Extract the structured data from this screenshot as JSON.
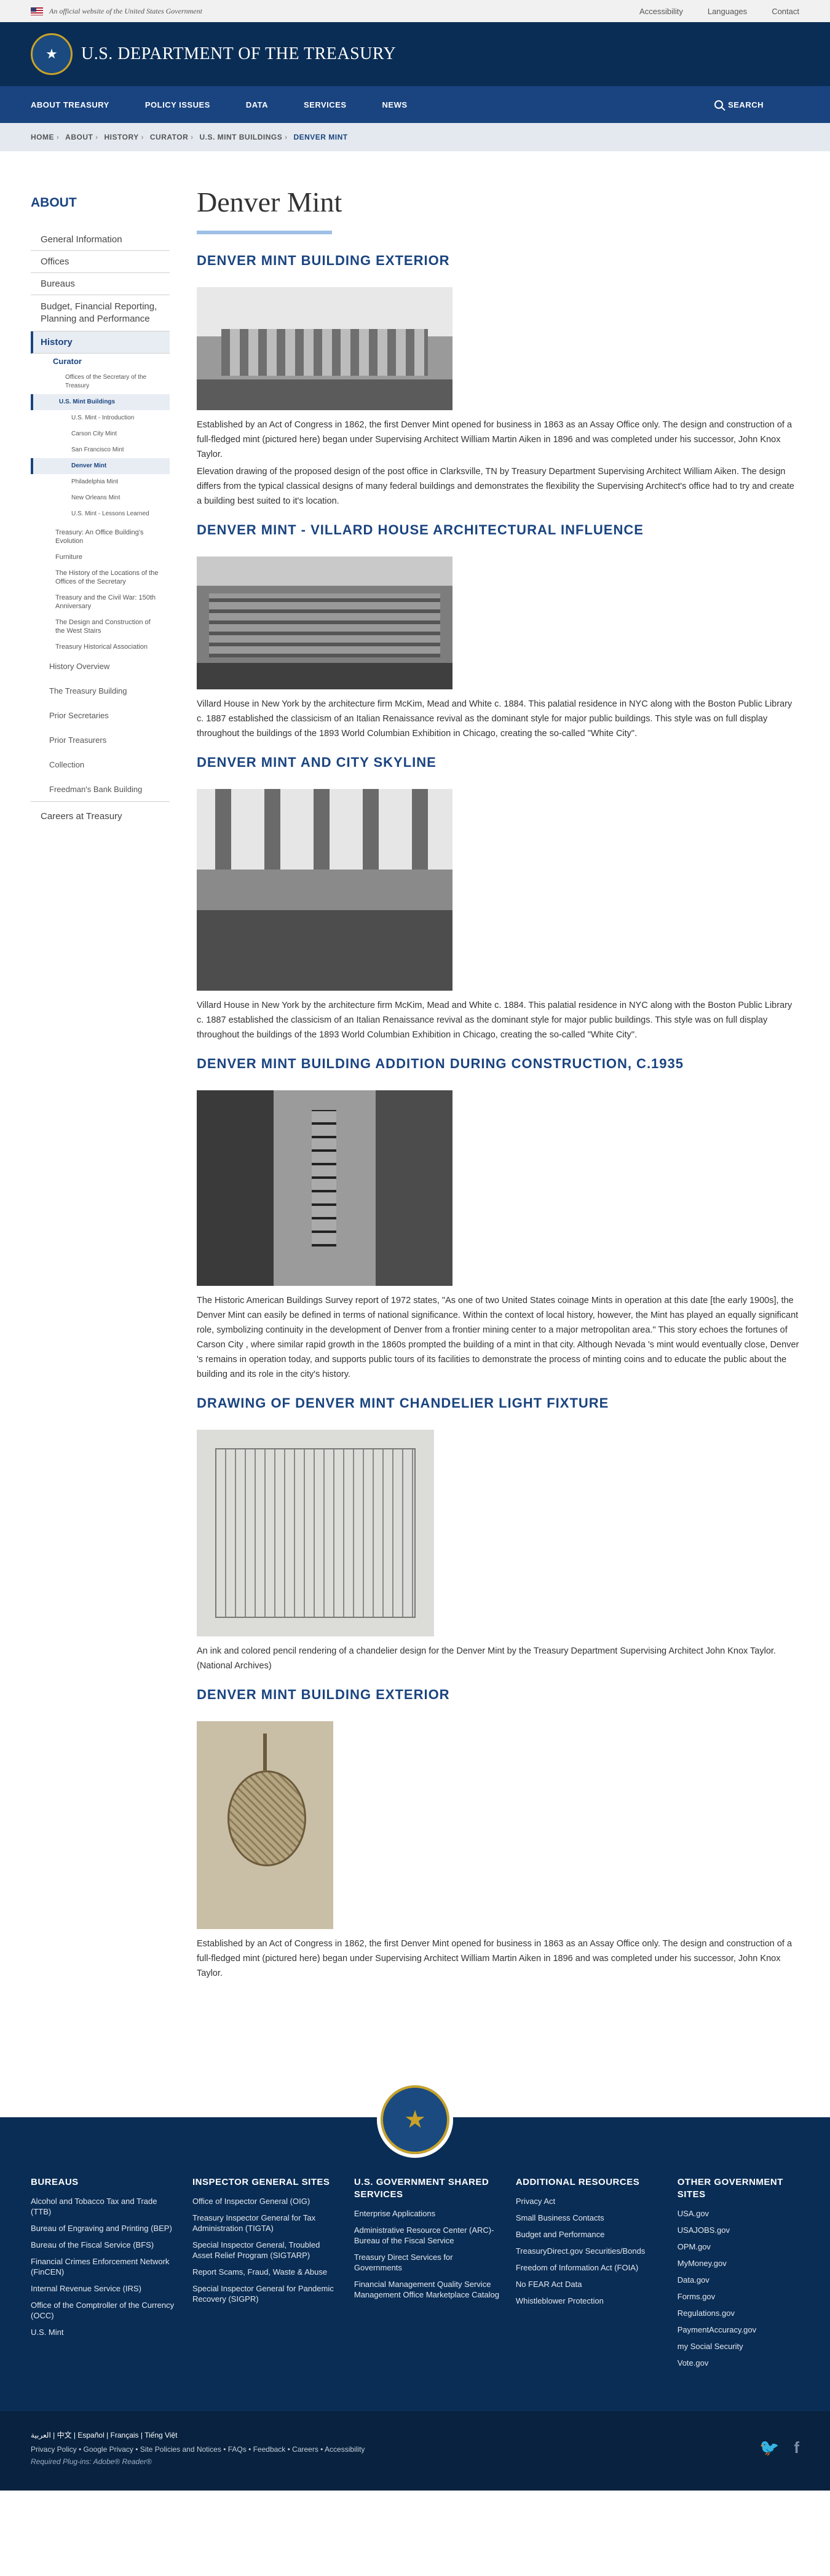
{
  "banner": {
    "official": "An official website of the United States Government",
    "links": [
      "Accessibility",
      "Languages",
      "Contact"
    ]
  },
  "header": {
    "site_title": "U.S. DEPARTMENT OF THE TREASURY"
  },
  "nav": {
    "items": [
      "ABOUT TREASURY",
      "POLICY ISSUES",
      "DATA",
      "SERVICES",
      "NEWS"
    ],
    "search": "SEARCH"
  },
  "breadcrumb": [
    "HOME",
    "ABOUT",
    "HISTORY",
    "CURATOR",
    "U.S. MINT BUILDINGS",
    "DENVER MINT"
  ],
  "sidebar": {
    "heading": "ABOUT",
    "top_items": [
      "General Information",
      "Offices",
      "Bureaus",
      "Budget, Financial Reporting, Planning and Performance"
    ],
    "history": "History",
    "curator": "Curator",
    "curator_items": [
      "Offices of the Secretary of the Treasury"
    ],
    "mint_buildings": "U.S. Mint Buildings",
    "mint_items": [
      "U.S. Mint - Introduction",
      "Carson City Mint",
      "San Francisco Mint",
      "Denver Mint",
      "Philadelphia Mint",
      "New Orleans Mint",
      "U.S. Mint - Lessons Learned"
    ],
    "curator_after": [
      "Treasury: An Office Building's Evolution",
      "Furniture",
      "The History of the Locations of the Offices of the Secretary",
      "Treasury and the Civil War: 150th Anniversary",
      "The Design and Construction of the West Stairs",
      "Treasury Historical Association"
    ],
    "history_after": [
      "History Overview",
      "The Treasury Building",
      "Prior Secretaries",
      "Prior Treasurers",
      "Collection",
      "Freedman's Bank Building"
    ],
    "bottom": "Careers at Treasury"
  },
  "page": {
    "title": "Denver Mint",
    "sections": [
      {
        "heading": "DENVER MINT BUILDING EXTERIOR",
        "paragraphs": [
          "Established by an Act of Congress in 1862, the first Denver Mint opened for business in 1863 as an Assay Office only. The design and construction of a full-fledged mint (pictured here) began under Supervising Architect William Martin Aiken in 1896 and was completed under his successor, John Knox Taylor.",
          "Elevation drawing of the proposed design of the post office in Clarksville, TN by Treasury Department Supervising Architect William Aiken. The design differs from the typical classical designs of many federal buildings and demonstrates the flexibility the Supervising Architect's office had to try and create a building best suited to it's location."
        ]
      },
      {
        "heading": "DENVER MINT - VILLARD HOUSE ARCHITECTURAL INFLUENCE",
        "paragraphs": [
          "Villard House in New York by the architecture firm McKim, Mead and White c. 1884. This palatial residence in NYC along with the Boston Public Library c. 1887 established the classicism of an Italian Renaissance revival as the dominant style for major public buildings. This style was on full display throughout the buildings of the 1893 World Columbian Exhibition in Chicago, creating the so-called \"White City\"."
        ]
      },
      {
        "heading": "DENVER MINT AND CITY SKYLINE",
        "paragraphs": [
          "Villard House in New York by the architecture firm McKim, Mead and White c. 1884. This palatial residence in NYC along with the Boston Public Library c. 1887 established the classicism of an Italian Renaissance revival as the dominant style for major public buildings. This style was on full display throughout the buildings of the 1893 World Columbian Exhibition in Chicago, creating the so-called \"White City\"."
        ]
      },
      {
        "heading": "DENVER MINT BUILDING ADDITION DURING CONSTRUCTION, C.1935",
        "paragraphs": [
          "The Historic American Buildings Survey report of 1972 states, \"As one of two United States coinage Mints in operation at this date [the early 1900s], the Denver Mint can easily be defined in terms of national significance. Within the context of local history, however, the Mint has played an equally significant role, symbolizing continuity in the development of Denver from a frontier mining center to a major metropolitan area.\" This story echoes the fortunes of Carson City , where similar rapid growth in the 1860s prompted the building of a mint in that city. Although Nevada 's mint would eventually close, Denver 's remains in operation today, and supports public tours of its facilities to demonstrate the process of minting coins and to educate the public about the building and its role in the city's history."
        ]
      },
      {
        "heading": "DRAWING OF DENVER MINT CHANDELIER LIGHT FIXTURE",
        "paragraphs": [
          "An ink and colored pencil rendering of a chandelier design for the Denver Mint by the Treasury Department Supervising Architect John Knox Taylor. (National Archives)"
        ]
      },
      {
        "heading": "DENVER MINT BUILDING EXTERIOR",
        "paragraphs": [
          "Established by an Act of Congress in 1862, the first Denver Mint opened for business in 1863 as an Assay Office only. The design and construction of a full-fledged mint (pictured here) began under Supervising Architect William Martin Aiken in 1896 and was completed under his successor, John Knox Taylor."
        ]
      }
    ]
  },
  "footer": {
    "columns": [
      {
        "heading": "BUREAUS",
        "links": [
          "Alcohol and Tobacco Tax and Trade (TTB)",
          "Bureau of Engraving and Printing (BEP)",
          "Bureau of the Fiscal Service (BFS)",
          "Financial Crimes Enforcement Network (FinCEN)",
          "Internal Revenue Service (IRS)",
          "Office of the Comptroller of the Currency (OCC)",
          "U.S. Mint"
        ]
      },
      {
        "heading": "INSPECTOR GENERAL SITES",
        "links": [
          "Office of Inspector General (OIG)",
          "Treasury Inspector General for Tax Administration (TIGTA)",
          "Special Inspector General, Troubled Asset Relief Program (SIGTARP)",
          "Report Scams, Fraud, Waste & Abuse",
          "Special Inspector General for Pandemic Recovery (SIGPR)"
        ]
      },
      {
        "heading": "U.S. GOVERNMENT SHARED SERVICES",
        "links": [
          "Enterprise Applications",
          "Administrative Resource Center (ARC)- Bureau of the Fiscal Service",
          "Treasury Direct Services for Governments",
          "Financial Management Quality Service Management Office Marketplace Catalog"
        ]
      },
      {
        "heading": "ADDITIONAL RESOURCES",
        "links": [
          "Privacy Act",
          "Small Business Contacts",
          "Budget and Performance",
          "TreasuryDirect.gov Securities/Bonds",
          "Freedom of Information Act (FOIA)",
          "No FEAR Act Data",
          "Whistleblower Protection"
        ]
      },
      {
        "heading": "OTHER GOVERNMENT SITES",
        "links": [
          "USA.gov",
          "USAJOBS.gov",
          "OPM.gov",
          "MyMoney.gov",
          "Data.gov",
          "Forms.gov",
          "Regulations.gov",
          "PaymentAccuracy.gov",
          "my Social Security",
          "Vote.gov"
        ]
      }
    ],
    "languages": "العربية | 中文 | Español | Français | Tiếng Việt",
    "links": "Privacy Policy • Google Privacy • Site Policies and Notices • FAQs • Feedback • Careers • Accessibility",
    "plugin": "Required Plug-ins: Adobe® Reader®"
  }
}
